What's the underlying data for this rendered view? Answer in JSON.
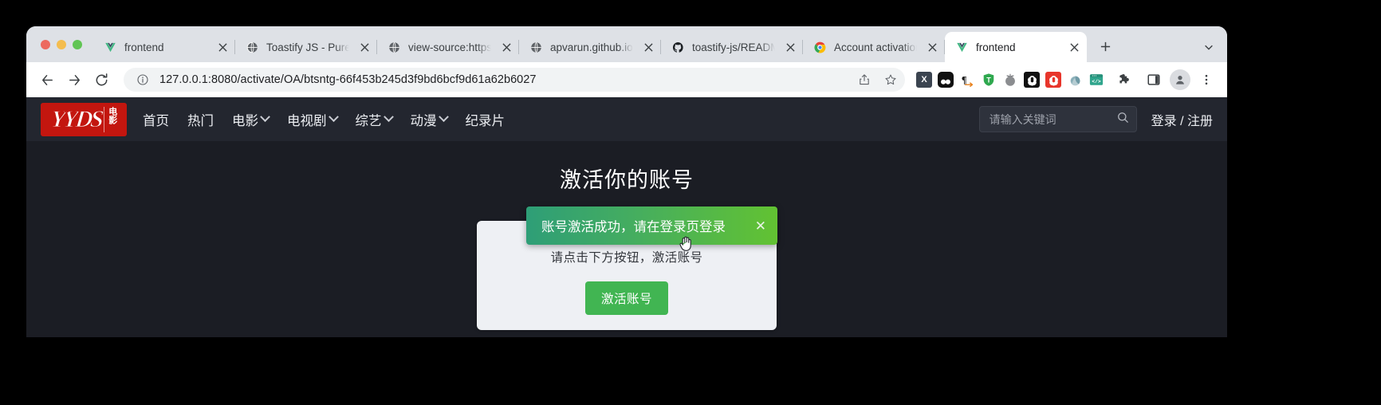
{
  "browser": {
    "tabs": [
      {
        "title": "frontend",
        "favicon": "vue-icon",
        "active": false
      },
      {
        "title": "Toastify JS - Pure",
        "favicon": "globe-icon",
        "active": false
      },
      {
        "title": "view-source:https",
        "favicon": "globe-icon",
        "active": false
      },
      {
        "title": "apvarun.github.io/",
        "favicon": "globe-icon",
        "active": false
      },
      {
        "title": "toastify-js/READM",
        "favicon": "github-icon",
        "active": false
      },
      {
        "title": "Account activation",
        "favicon": "chrome-icon",
        "active": false
      },
      {
        "title": "frontend",
        "favicon": "vue-icon",
        "active": true
      }
    ],
    "new_tab_label": "+",
    "toolbar": {
      "back_icon": "back-arrow-icon",
      "forward_icon": "forward-arrow-icon",
      "reload_icon": "reload-icon",
      "site_info_icon": "info-circle-icon",
      "url": "127.0.0.1:8080/activate/OA/btsntg-66f453b245d3f9bd6bcf9d61a62b6027",
      "share_icon": "share-icon",
      "bookmark_icon": "star-icon",
      "extensions": [
        {
          "name": "x-extension-icon",
          "glyph": "X",
          "bg": "#3b4450",
          "fg": "#ffffff"
        },
        {
          "name": "panda-extension-icon",
          "glyph": "",
          "bg": "#000000",
          "fg": "#ffffff"
        },
        {
          "name": "paragraph-extension-icon",
          "glyph": "¶",
          "bg": "transparent",
          "fg": "#222222"
        },
        {
          "name": "shield-t-extension-icon",
          "glyph": "T",
          "bg": "#2fa84f",
          "fg": "#ffffff"
        },
        {
          "name": "tomato-timer-extension-icon",
          "glyph": "",
          "bg": "#8b8d90",
          "fg": "#ffffff"
        },
        {
          "name": "openai-dark-extension-icon",
          "glyph": "",
          "bg": "#111111",
          "fg": "#ffffff"
        },
        {
          "name": "openai-red-extension-icon",
          "glyph": "",
          "bg": "#e8352b",
          "fg": "#ffffff"
        },
        {
          "name": "swirl-extension-icon",
          "glyph": "",
          "bg": "transparent",
          "fg": "#6f9aa6"
        },
        {
          "name": "code-window-extension-icon",
          "glyph": "</>",
          "bg": "#2fa58c",
          "fg": "#ffffff"
        }
      ],
      "puzzle_icon": "puzzle-piece-icon",
      "sidebar_icon": "side-panel-icon",
      "profile_icon": "person-avatar-icon",
      "menu_icon": "three-dot-menu-icon"
    }
  },
  "site": {
    "logo": {
      "mark": "YYDS",
      "sub": "电影"
    },
    "nav": [
      {
        "label": "首页",
        "caret": false
      },
      {
        "label": "热门",
        "caret": false
      },
      {
        "label": "电影",
        "caret": true
      },
      {
        "label": "电视剧",
        "caret": true
      },
      {
        "label": "综艺",
        "caret": true
      },
      {
        "label": "动漫",
        "caret": true
      },
      {
        "label": "纪录片",
        "caret": false
      }
    ],
    "search": {
      "placeholder": "请输入关键词",
      "icon": "search-icon"
    },
    "login_register": "登录 / 注册"
  },
  "toast": {
    "message": "账号激活成功，请在登录页登录",
    "close_label": "✕",
    "color_start": "#2e9e77",
    "color_end": "#62c232"
  },
  "main": {
    "title": "激活你的账号",
    "card": {
      "instruction": "请点击下方按钮，激活账号",
      "button_label": "激活账号",
      "button_color": "#41b552"
    }
  }
}
